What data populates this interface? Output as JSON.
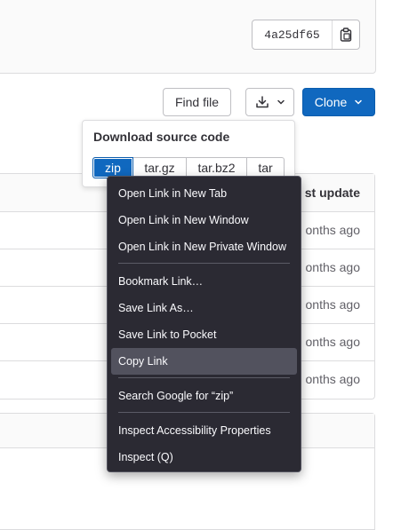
{
  "commit": {
    "sha": "4a25df65"
  },
  "toolbar": {
    "find_file": "Find file",
    "clone": "Clone"
  },
  "download_panel": {
    "title": "Download source code",
    "formats": [
      "zip",
      "tar.gz",
      "tar.bz2",
      "tar"
    ],
    "selected": "zip"
  },
  "table": {
    "last_update_header": "st update",
    "rows": [
      "onths ago",
      "onths ago",
      "onths ago",
      "onths ago",
      "onths ago"
    ]
  },
  "context_menu": {
    "items": [
      "Open Link in New Tab",
      "Open Link in New Window",
      "Open Link in New Private Window",
      "Bookmark Link…",
      "Save Link As…",
      "Save Link to Pocket",
      "Copy Link",
      "Search Google for “zip”",
      "Inspect Accessibility Properties",
      "Inspect (Q)"
    ],
    "hovered": "Copy Link"
  },
  "colors": {
    "primary": "#1068bf",
    "menu_bg": "#2b2a33",
    "menu_hover": "#52525e"
  }
}
